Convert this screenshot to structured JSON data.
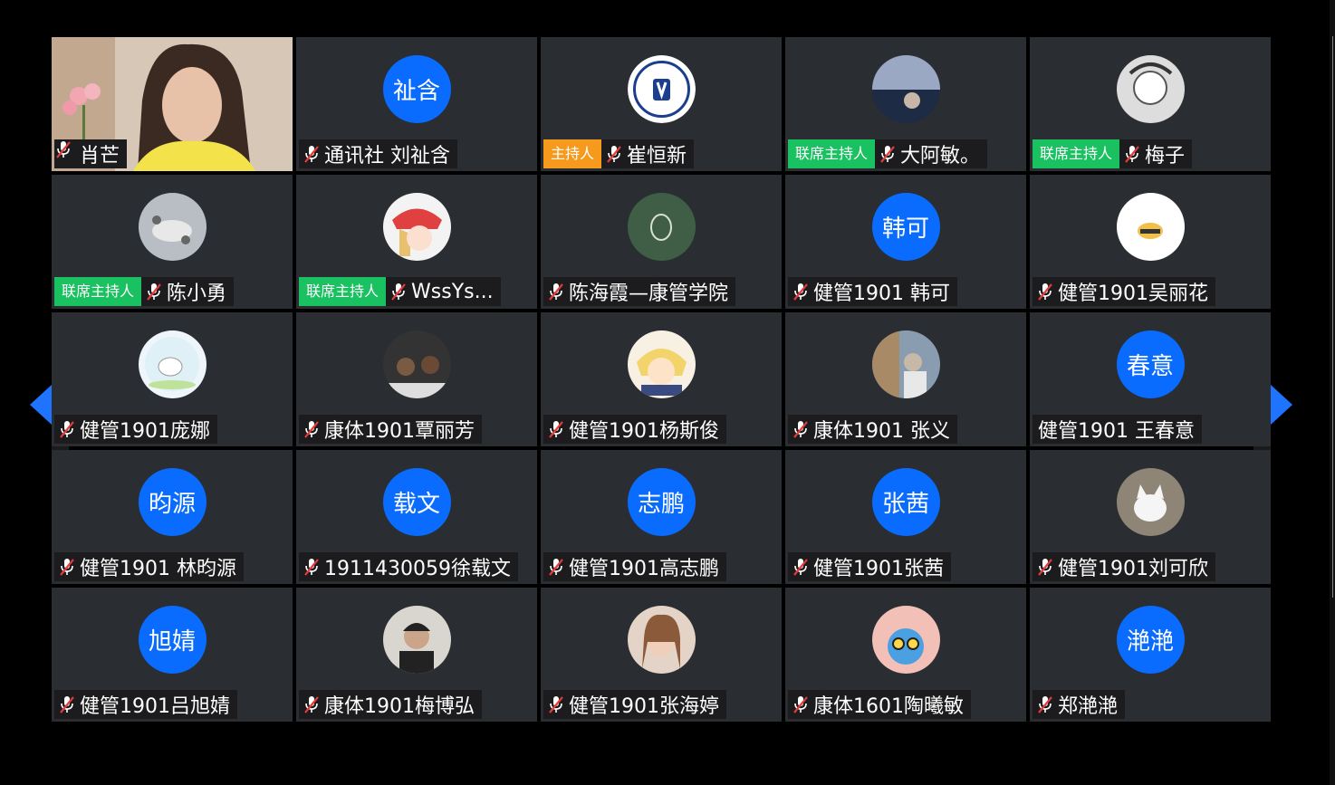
{
  "tiles": [
    {
      "name": "肖芒",
      "avatar_kind": "video",
      "muted": true
    },
    {
      "name": "通讯社 刘祉含",
      "avatar_text": "祉含",
      "muted": true
    },
    {
      "name": "崔恒新",
      "avatar_kind": "university-logo",
      "role": "主持人",
      "role_color": "#f59a1d",
      "muted": true
    },
    {
      "name": "大阿敏。",
      "avatar_kind": "photo-sea",
      "role": "联席主持人",
      "role_color": "#19c160",
      "muted": true
    },
    {
      "name": "梅子",
      "avatar_kind": "photo-sketch",
      "role": "联席主持人",
      "role_color": "#19c160",
      "muted": true
    },
    {
      "name": "陈小勇",
      "avatar_kind": "photo-meeting",
      "role": "联席主持人",
      "role_color": "#19c160",
      "muted": true
    },
    {
      "name": "WssYs...",
      "avatar_kind": "photo-anime",
      "role": "联席主持人",
      "role_color": "#19c160",
      "muted": true
    },
    {
      "name": "陈海霞—康管学院",
      "avatar_kind": "photo-green-doodle",
      "muted": true
    },
    {
      "name": "健管1901 韩可",
      "avatar_text": "韩可",
      "muted": true
    },
    {
      "name": "健管1901吴丽花",
      "avatar_kind": "photo-bun",
      "muted": true
    },
    {
      "name": "健管1901庞娜",
      "avatar_kind": "photo-bear",
      "muted": true
    },
    {
      "name": "康体1901覃丽芳",
      "avatar_kind": "photo-basketball",
      "muted": true
    },
    {
      "name": "健管1901杨斯俊",
      "avatar_kind": "photo-cartoon",
      "muted": true
    },
    {
      "name": "康体1901 张义",
      "avatar_kind": "photo-person",
      "muted": true
    },
    {
      "name": "健管1901 王春意",
      "avatar_text": "春意",
      "muted": false
    },
    {
      "name": "健管1901 林昀源",
      "avatar_text": "昀源",
      "muted": true
    },
    {
      "name": "1911430059徐载文",
      "avatar_text": "载文",
      "muted": true
    },
    {
      "name": "健管1901高志鹏",
      "avatar_text": "志鹏",
      "muted": true
    },
    {
      "name": "健管1901张茜",
      "avatar_text": "张茜",
      "muted": true
    },
    {
      "name": "健管1901刘可欣",
      "avatar_kind": "photo-cat",
      "muted": true
    },
    {
      "name": "健管1901吕旭婧",
      "avatar_text": "旭婧",
      "muted": true
    },
    {
      "name": "康体1901梅博弘",
      "avatar_kind": "photo-man",
      "muted": true
    },
    {
      "name": "健管1901张海婷",
      "avatar_kind": "photo-woman",
      "muted": true
    },
    {
      "name": "康体1601陶曦敏",
      "avatar_kind": "photo-blue-cat",
      "muted": true
    },
    {
      "name": "郑滟滟",
      "avatar_text": "滟滟",
      "muted": true
    }
  ],
  "colors": {
    "avatar_blue": "#0a6cff",
    "cohost_green": "#19c160",
    "host_orange": "#f59a1d",
    "nav_blue": "#1e73ff"
  },
  "icons": {
    "muted": "mic-off-icon",
    "prev": "chevron-left-icon",
    "next": "chevron-right-icon"
  }
}
